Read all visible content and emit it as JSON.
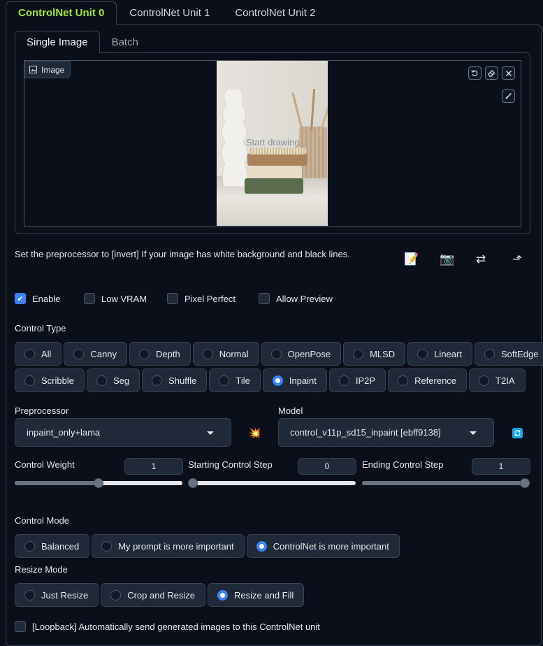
{
  "unit_tabs": [
    "ControlNet Unit 0",
    "ControlNet Unit 1",
    "ControlNet Unit 2"
  ],
  "image_tabs": [
    "Single Image",
    "Batch"
  ],
  "image_label": "Image",
  "canvas_hint": "Start drawing",
  "hint_text": "Set the preprocessor to [invert] If your image has white background and black lines.",
  "checkboxes": [
    {
      "label": "Enable",
      "checked": true
    },
    {
      "label": "Low VRAM",
      "checked": false
    },
    {
      "label": "Pixel Perfect",
      "checked": false
    },
    {
      "label": "Allow Preview",
      "checked": false
    }
  ],
  "control_type": {
    "label": "Control Type",
    "row1": [
      "All",
      "Canny",
      "Depth",
      "Normal",
      "OpenPose",
      "MLSD",
      "Lineart",
      "SoftEdge"
    ],
    "row2": [
      "Scribble",
      "Seg",
      "Shuffle",
      "Tile",
      "Inpaint",
      "IP2P",
      "Reference",
      "T2IA"
    ],
    "selected": "Inpaint"
  },
  "preprocessor": {
    "label": "Preprocessor",
    "value": "inpaint_only+lama"
  },
  "model": {
    "label": "Model",
    "value": "control_v11p_sd15_inpaint [ebff9138]"
  },
  "control_weight": {
    "label": "Control Weight",
    "value": "1",
    "fraction": 0.5
  },
  "starting_step": {
    "label": "Starting Control Step",
    "value": "0",
    "fraction": 0.0
  },
  "ending_step": {
    "label": "Ending Control Step",
    "value": "1",
    "fraction": 1.0
  },
  "control_mode": {
    "label": "Control Mode",
    "options": [
      "Balanced",
      "My prompt is more important",
      "ControlNet is more important"
    ],
    "selected": "ControlNet is more important"
  },
  "resize_mode": {
    "label": "Resize Mode",
    "options": [
      "Just Resize",
      "Crop and Resize",
      "Resize and Fill"
    ],
    "selected": "Resize and Fill"
  },
  "loopback": {
    "label": "[Loopback] Automatically send generated images to this ControlNet unit",
    "checked": false
  },
  "colors": {
    "accent": "#3b82f6",
    "active_tab": "#a3e635",
    "background": "#0b0f19",
    "panel": "#1f2937"
  }
}
